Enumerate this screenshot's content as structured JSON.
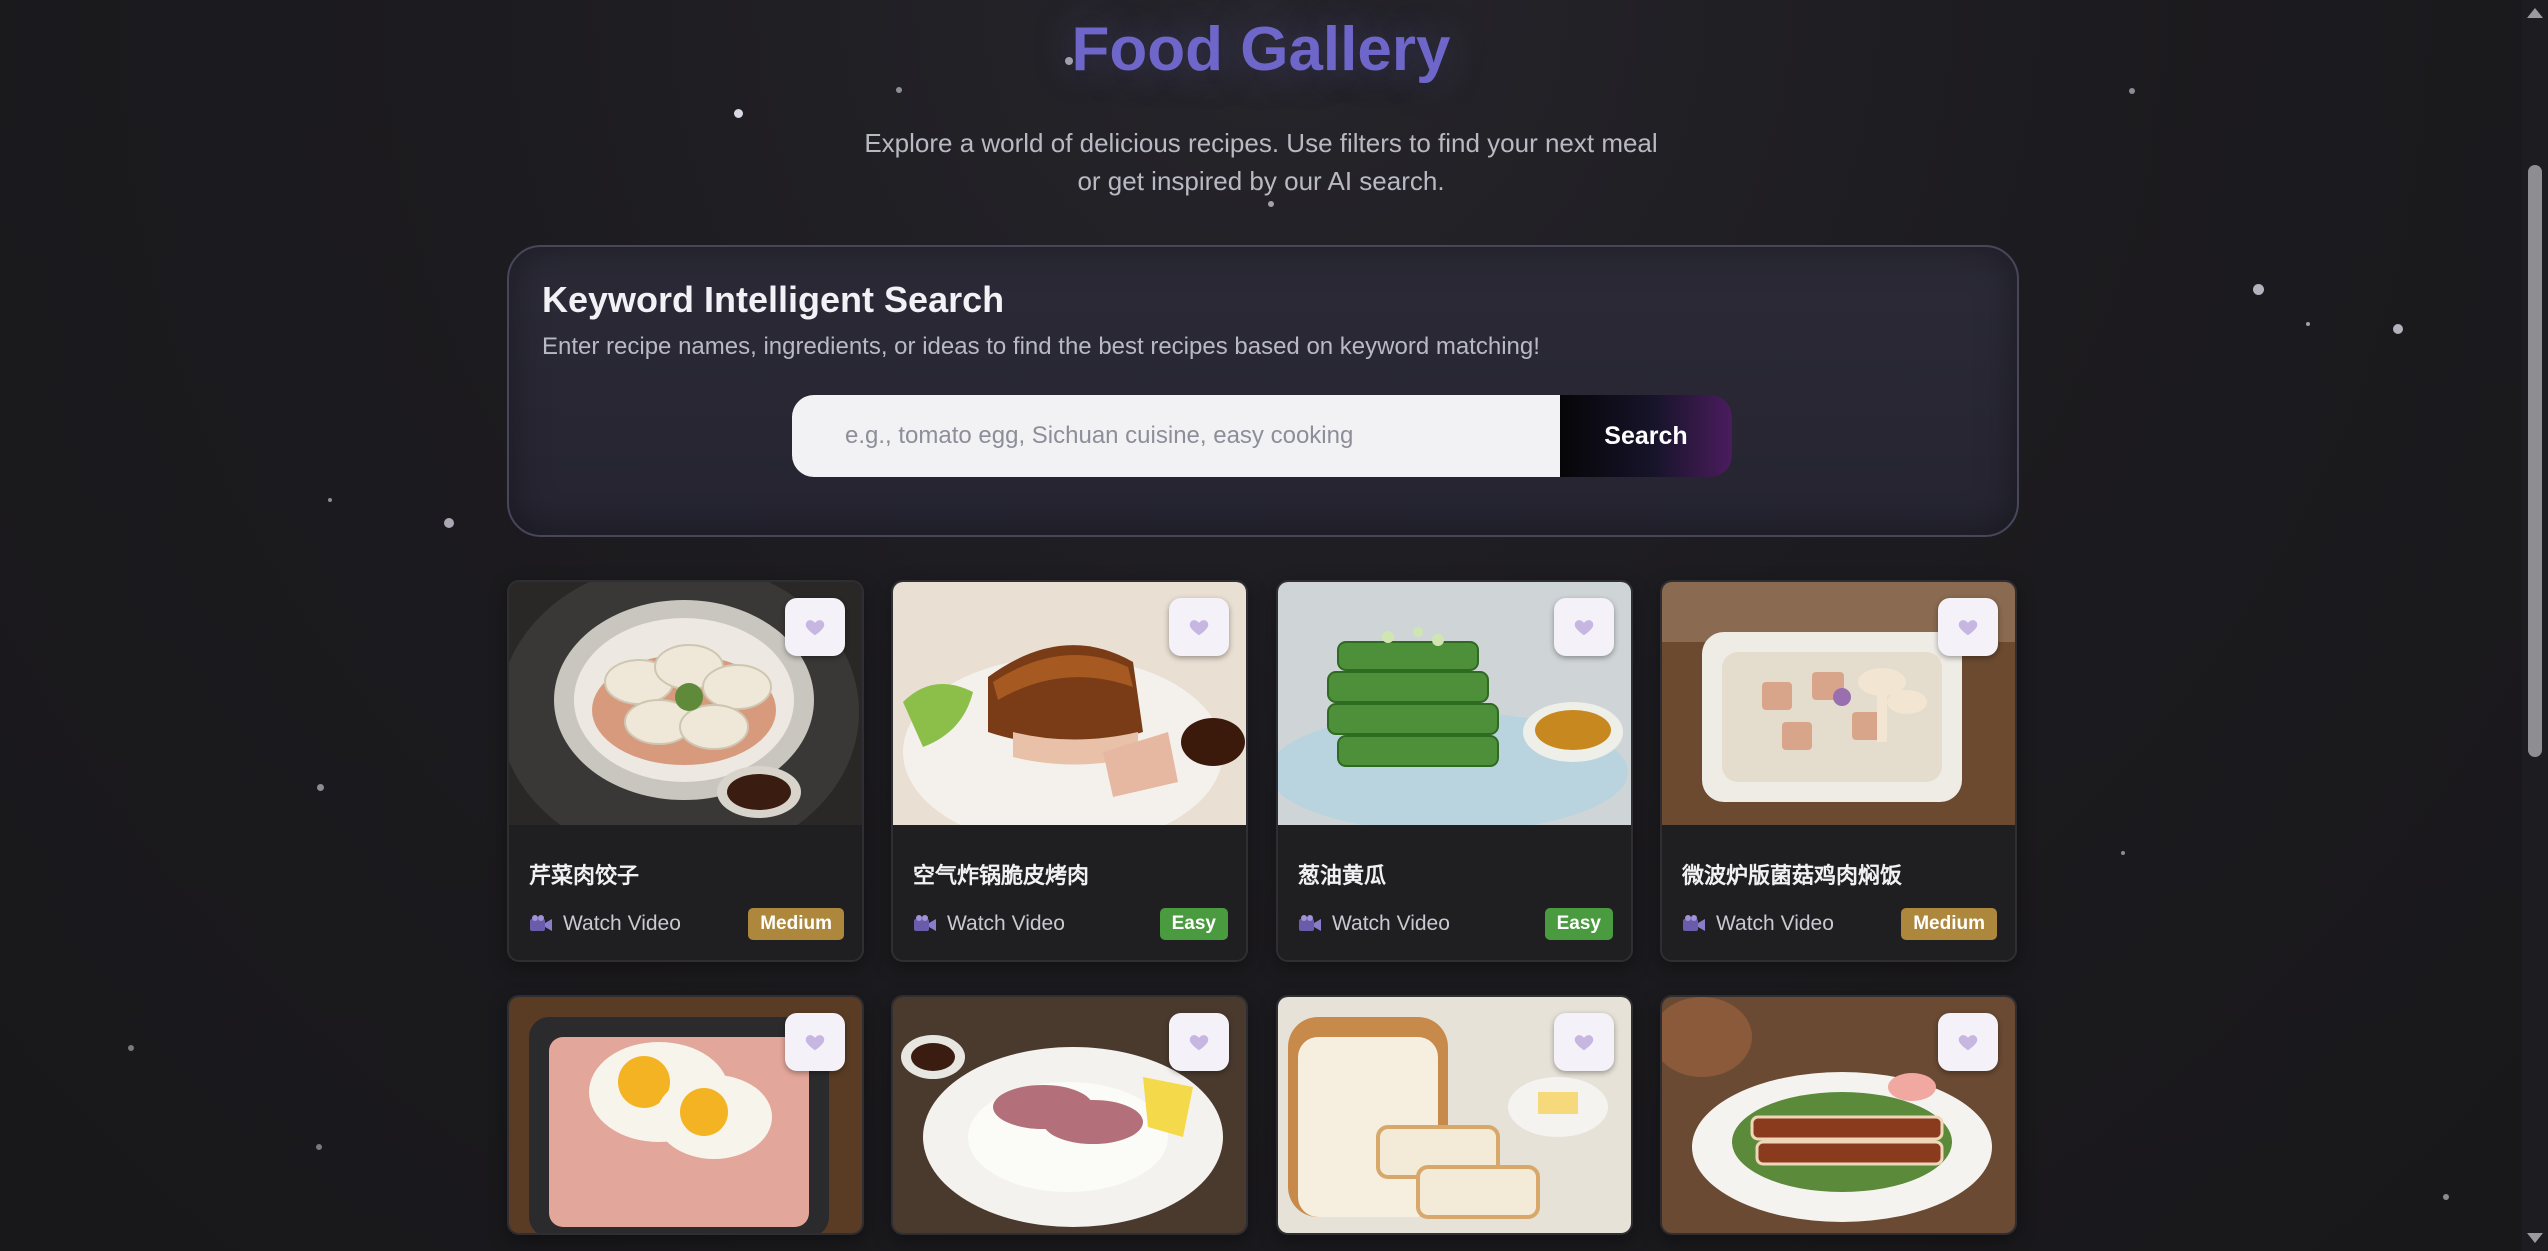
{
  "header": {
    "title": "Food Gallery",
    "subtitle_line1": "Explore a world of delicious recipes. Use filters to find your next meal",
    "subtitle_line2": "or get inspired by our AI search."
  },
  "search": {
    "heading": "Keyword Intelligent Search",
    "description": "Enter recipe names, ingredients, or ideas to find the best recipes based on keyword matching!",
    "placeholder": "e.g., tomato egg, Sichuan cuisine, easy cooking",
    "value": "",
    "button_label": "Search"
  },
  "recipes": [
    {
      "title": "芹菜肉饺子",
      "link_label": "Watch Video",
      "difficulty": "Medium",
      "image": "dumplings-photo"
    },
    {
      "title": "空气炸锅脆皮烤肉",
      "link_label": "Watch Video",
      "difficulty": "Easy",
      "image": "crispy-pork-photo"
    },
    {
      "title": "葱油黄瓜",
      "link_label": "Watch Video",
      "difficulty": "Easy",
      "image": "cucumber-photo"
    },
    {
      "title": "微波炉版菌菇鸡肉焖饭",
      "link_label": "Watch Video",
      "difficulty": "Medium",
      "image": "mushroom-rice-photo"
    },
    {
      "image": "spam-eggs-photo"
    },
    {
      "image": "beef-rice-photo"
    },
    {
      "image": "bread-butter-photo"
    },
    {
      "image": "grilled-pork-photo"
    }
  ],
  "colors": {
    "accent": "#6f66c9",
    "medium_badge": "#ad873b",
    "easy_badge": "#4a9a3f"
  },
  "icons": {
    "favorite": "heart-icon",
    "video": "video-camera-icon"
  }
}
